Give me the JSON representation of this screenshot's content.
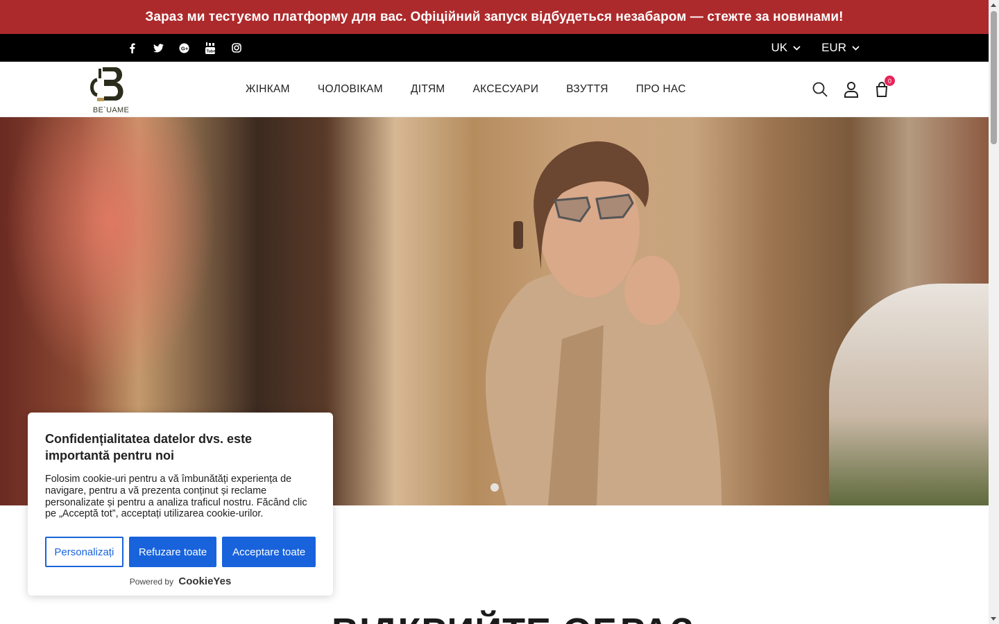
{
  "announcement": {
    "text": "Зараз ми тестуємо платформу для вас. Офіційний запуск відбудеться незабаром — стежте за новинами!"
  },
  "topbar": {
    "social": [
      "facebook-icon",
      "twitter-icon",
      "google-plus-icon",
      "youtube-icon",
      "instagram-icon"
    ],
    "language": "UK",
    "currency": "EUR"
  },
  "header": {
    "logo_text": "BE`UAME",
    "nav": [
      "ЖІНКАМ",
      "ЧОЛОВІКАМ",
      "ДІТЯМ",
      "АКСЕСУАРИ",
      "ВЗУТТЯ",
      "ПРО НАС"
    ],
    "cart_count": "0"
  },
  "section": {
    "title": "ВІДКРИЙТЕ ОБРАЗ"
  },
  "cookie": {
    "title": "Confidențialitatea datelor dvs. este importantă pentru noi",
    "text": "Folosim cookie-uri pentru a vă îmbunătăți experiența de navigare, pentru a vă prezenta conținut și reclame personalizate și pentru a analiza traficul nostru. Făcând clic pe „Acceptă tot”, acceptați utilizarea cookie-urilor.",
    "btn_customize": "Personalizați",
    "btn_reject": "Refuzare toate",
    "btn_accept": "Acceptare toate",
    "powered_by": "Powered by",
    "brand": "CookieYes"
  },
  "colors": {
    "announce_bg": "#ad2a2c",
    "primary_blue": "#1863dc",
    "badge": "#e6245a"
  }
}
